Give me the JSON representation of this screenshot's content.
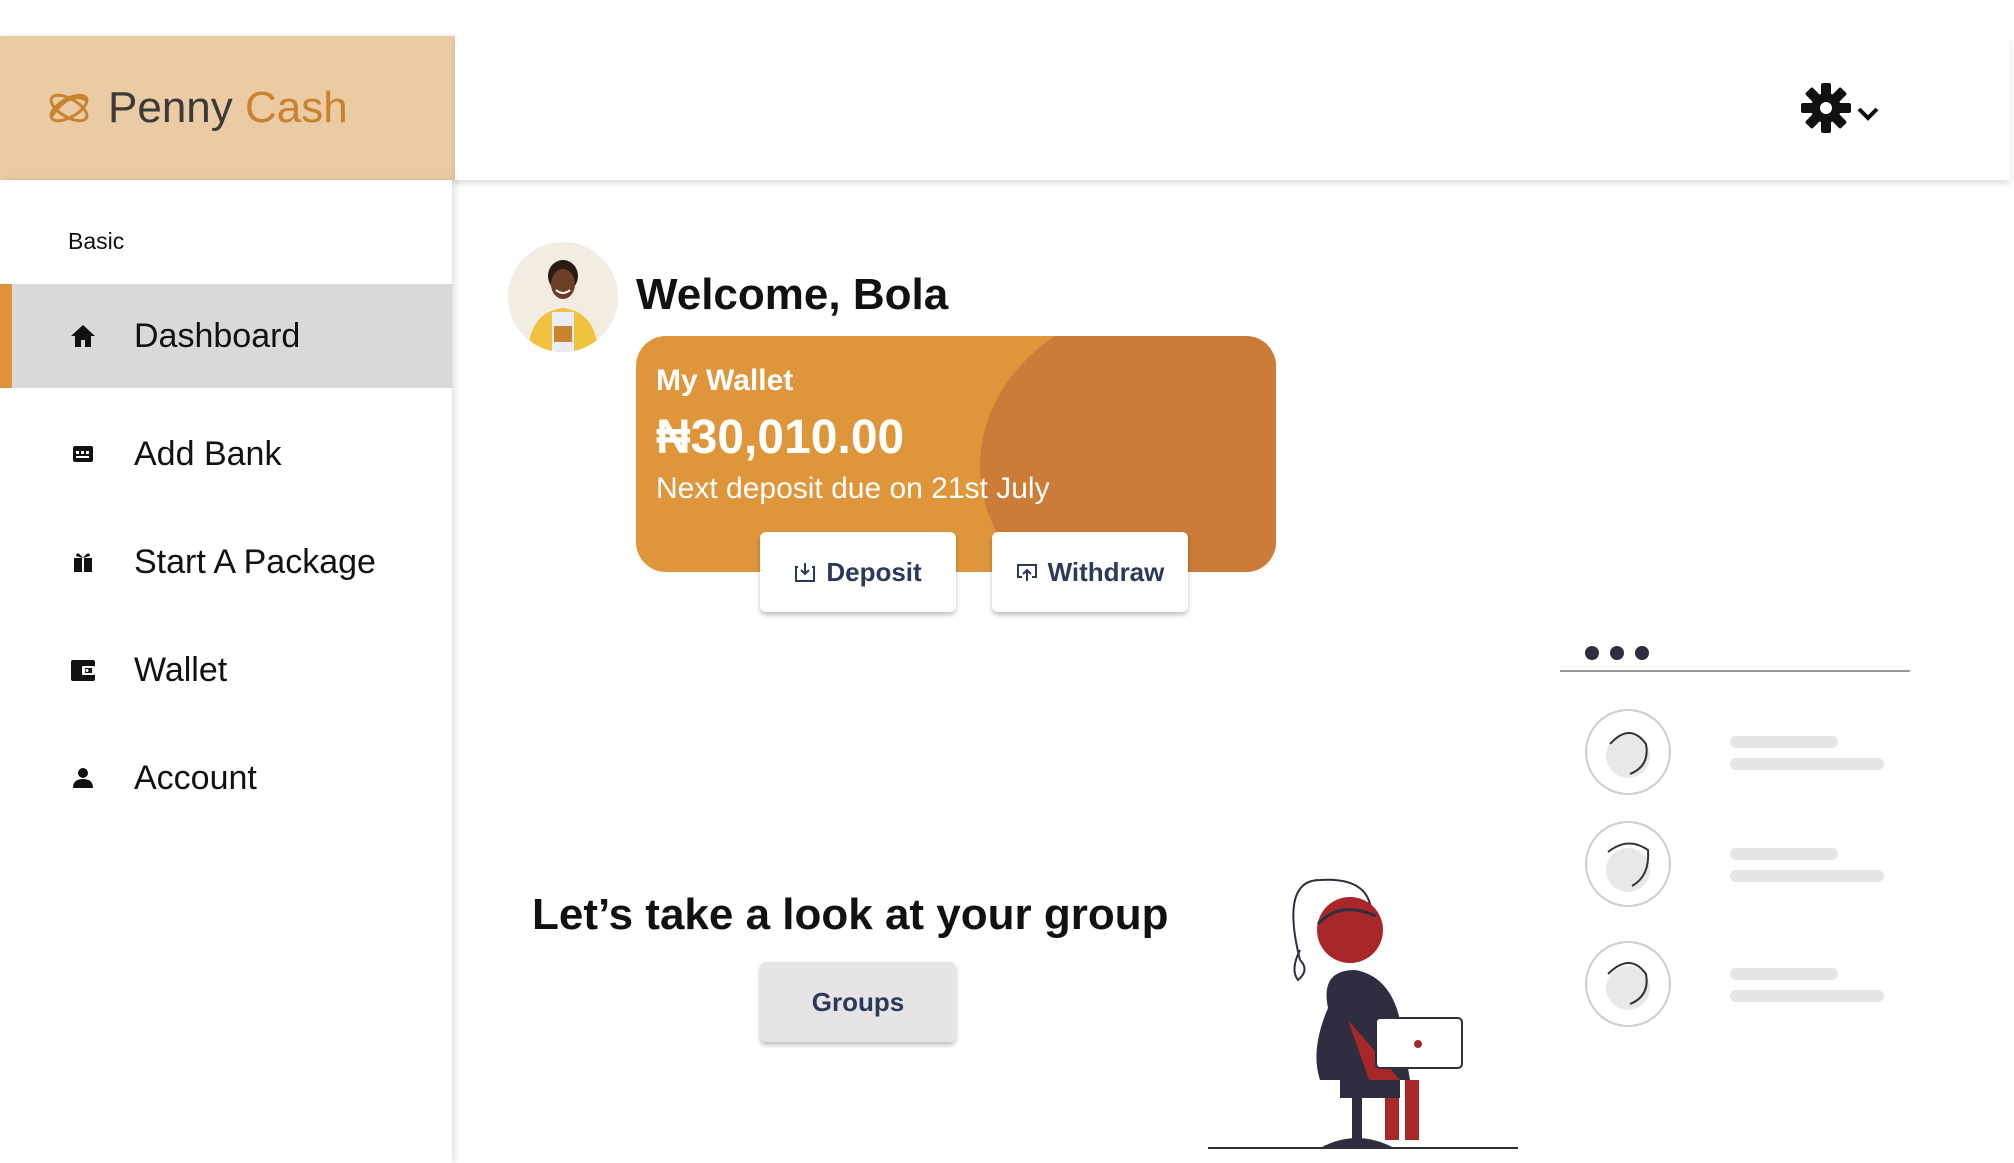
{
  "brand": {
    "name_part1": "Penny",
    "name_part2": "Cash",
    "logo_icon": "swirl-logo-icon"
  },
  "header": {
    "settings_icon": "gear-icon",
    "dropdown_icon": "chevron-down-icon"
  },
  "sidebar": {
    "tier": "Basic",
    "items": [
      {
        "label": "Dashboard",
        "icon": "home-icon",
        "active": true
      },
      {
        "label": "Add Bank",
        "icon": "bank-card-icon",
        "active": false
      },
      {
        "label": "Start A Package",
        "icon": "gift-icon",
        "active": false
      },
      {
        "label": "Wallet",
        "icon": "wallet-icon",
        "active": false
      },
      {
        "label": "Account",
        "icon": "person-icon",
        "active": false
      }
    ]
  },
  "main": {
    "welcome": "Welcome, Bola",
    "wallet": {
      "title": "My Wallet",
      "amount": "₦30,010.00",
      "due": "Next deposit due on 21st July",
      "deposit_label": "Deposit",
      "withdraw_label": "Withdraw"
    },
    "groups": {
      "title": "Let’s take a look at your group",
      "button_label": "Groups"
    }
  },
  "colors": {
    "brand_bg": "#ebcba3",
    "accent": "#e09238",
    "wallet_bg": "#df963b",
    "wallet_blob": "#cc7b38",
    "button_text": "#2b3a5c",
    "illustration_red": "#a8282a",
    "illustration_dark": "#2f2e41"
  }
}
